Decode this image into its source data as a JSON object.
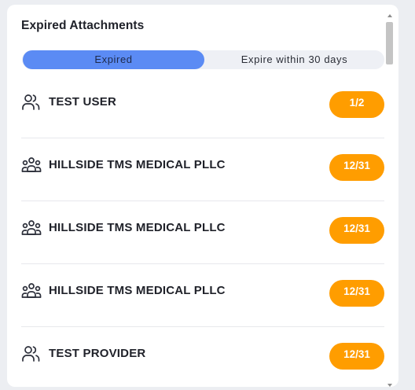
{
  "card": {
    "title": "Expired Attachments"
  },
  "toggle": {
    "active_label": "Expired",
    "inactive_label": "Expire within 30 days"
  },
  "rows": [
    {
      "name": "TEST USER",
      "badge": "1/2",
      "icon": "user-group-icon"
    },
    {
      "name": "HILLSIDE TMS MEDICAL PLLC",
      "badge": "12/31",
      "icon": "organization-icon"
    },
    {
      "name": "HILLSIDE TMS MEDICAL PLLC",
      "badge": "12/31",
      "icon": "organization-icon"
    },
    {
      "name": "HILLSIDE TMS MEDICAL PLLC",
      "badge": "12/31",
      "icon": "organization-icon"
    },
    {
      "name": "TEST PROVIDER",
      "badge": "12/31",
      "icon": "user-group-icon"
    }
  ],
  "colors": {
    "accent": "#5b8bf4",
    "badge": "#ff9d00",
    "text": "#20222a"
  }
}
